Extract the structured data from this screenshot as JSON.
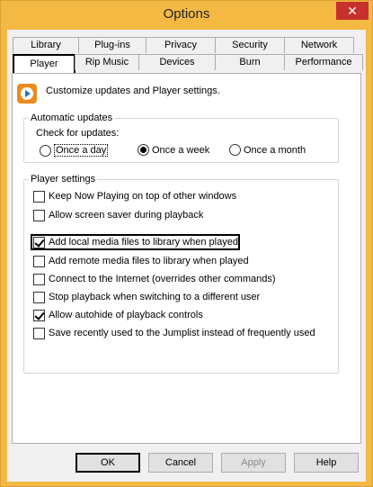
{
  "window": {
    "title": "Options",
    "close_glyph": "✕"
  },
  "tabs_row1": [
    "Library",
    "Plug-ins",
    "Privacy",
    "Security",
    "Network"
  ],
  "tabs_row2": [
    "Player",
    "Rip Music",
    "Devices",
    "Burn",
    "Performance"
  ],
  "selected_tab": "Player",
  "header": {
    "icon": "media-player-icon",
    "text": "Customize updates and Player settings."
  },
  "auto_updates": {
    "legend": "Automatic updates",
    "check_label": "Check for updates:",
    "options": [
      "Once a day",
      "Once a week",
      "Once a month"
    ],
    "selected": "Once a week"
  },
  "player_settings": {
    "legend": "Player settings",
    "items": [
      {
        "label": "Keep Now Playing on top of other windows",
        "checked": false
      },
      {
        "label": "Allow screen saver during playback",
        "checked": false
      },
      {
        "label": "Add local media files to library when played",
        "checked": true
      },
      {
        "label": "Add remote media files to library when played",
        "checked": false
      },
      {
        "label": "Connect to the Internet (overrides other commands)",
        "checked": false
      },
      {
        "label": "Stop playback when switching to a different user",
        "checked": false
      },
      {
        "label": "Allow autohide of playback controls",
        "checked": true
      },
      {
        "label": "Save recently used to the Jumplist instead of frequently used",
        "checked": false
      }
    ]
  },
  "buttons": {
    "ok": "OK",
    "cancel": "Cancel",
    "apply": "Apply",
    "help": "Help"
  },
  "colors": {
    "titlebar": "#f4b942",
    "close": "#c7302c",
    "icon": "#f08a1c"
  }
}
